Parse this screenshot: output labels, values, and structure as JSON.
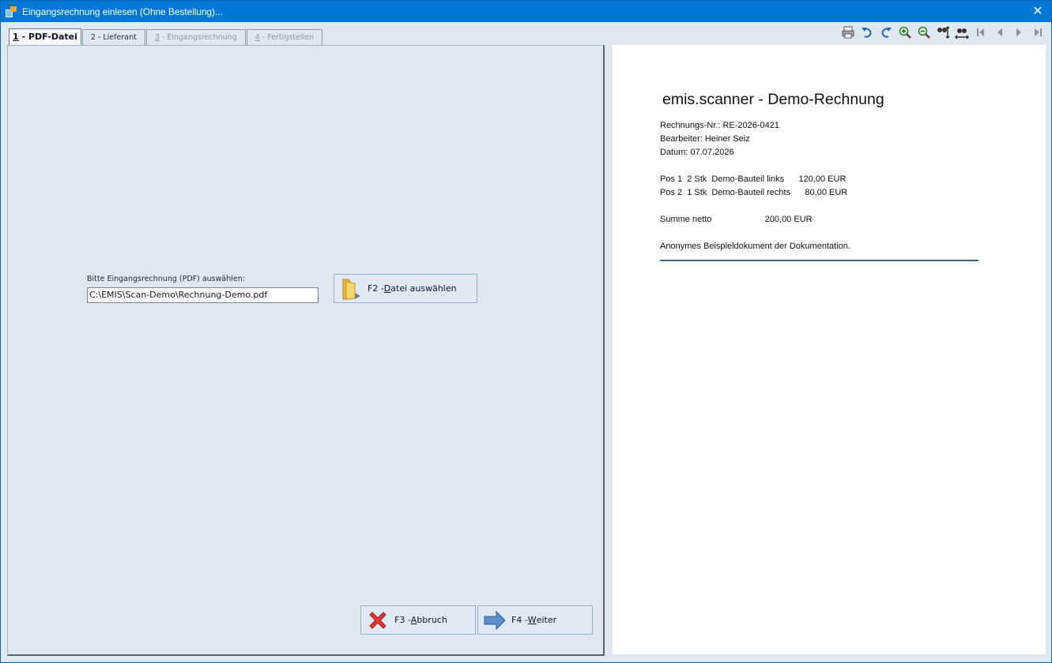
{
  "window": {
    "title": "Eingangsrechnung einlesen (Ohne Bestellung)...",
    "close_glyph": "✕"
  },
  "tabs": [
    {
      "key": "1",
      "label": " - PDF-Datei",
      "state": "active"
    },
    {
      "key": "2",
      "label": " - Lieferant",
      "state": "enabled"
    },
    {
      "key": "3",
      "label": " - Eingangsrechnung",
      "state": "disabled"
    },
    {
      "key": "4",
      "label": " - Fertigstellen",
      "state": "disabled"
    }
  ],
  "file_select": {
    "label": "Bitte Eingangsrechnung (PDF) auswählen:",
    "path_value": "C:\\EMIS\\Scan-Demo\\Rechnung-Demo.pdf",
    "button_prefix": "F2 - ",
    "button_key": "D",
    "button_rest": "atei auswählen"
  },
  "actions": {
    "abort_prefix": "F3 - ",
    "abort_key": "A",
    "abort_rest": "bbruch",
    "next_prefix": "F4 - ",
    "next_key": "W",
    "next_rest": "eiter"
  },
  "viewer_toolbar": [
    "print-icon",
    "rotate-left-icon",
    "rotate-right-icon",
    "zoom-in-icon",
    "zoom-out-icon",
    "fit-width-icon",
    "fit-page-icon",
    "first-page-icon",
    "previous-page-icon",
    "next-page-icon",
    "last-page-icon"
  ],
  "document": {
    "title": "emis.scanner - Demo-Rechnung",
    "invoice_no": "Rechnungs-Nr.: RE-2026-0421",
    "clerk": "Bearbeiter: Heiner Seiz",
    "date": "Datum: 07.07.2026",
    "pos1": "Pos 1  2 Stk  Demo-Bauteil links      120,00 EUR",
    "pos2": "Pos 2  1 Stk  Demo-Bauteil rechts      80,00 EUR",
    "sum": "Summe netto                      200,00 EUR",
    "note": "Anonymes Beispieldokument der Dokumentation."
  },
  "colors": {
    "titlebar": "#0078d7",
    "panel": "#dfe7f1",
    "abort_icon": "#e53935",
    "next_icon": "#5b8fc7",
    "folder_icon": "#f2c94c"
  }
}
